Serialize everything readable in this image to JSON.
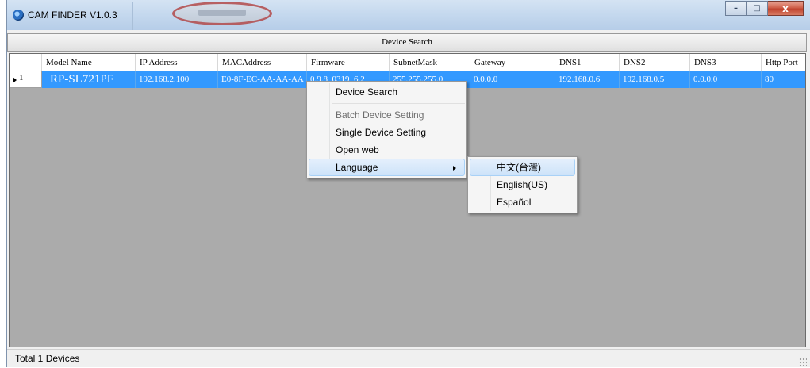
{
  "window": {
    "title": "CAM FINDER V1.0.3",
    "controls": {
      "minimize": "–",
      "maximize": "□",
      "close": "x"
    }
  },
  "toolbar": {
    "device_search_label": "Device Search"
  },
  "grid": {
    "columns": [
      "Model Name",
      "IP Address",
      "MACAddress",
      "Firmware",
      "SubnetMask",
      "Gateway",
      "DNS1",
      "DNS2",
      "DNS3",
      "Http Port"
    ],
    "rows": [
      {
        "row_number": "1",
        "model_name": "RP-SL721PF",
        "ip_address": "192.168.2.100",
        "mac_address": "E0-8F-EC-AA-AA-AA",
        "firmware": "0.9.8_0319_6.2",
        "subnet_mask": "255.255.255.0",
        "gateway": "0.0.0.0",
        "dns1": "192.168.0.6",
        "dns2": "192.168.0.5",
        "dns3": "0.0.0.0",
        "http_port": "80"
      }
    ]
  },
  "context_menu": {
    "device_search": "Device Search",
    "batch_device_setting": "Batch Device Setting",
    "single_device_setting": "Single Device Setting",
    "open_web": "Open web",
    "language": "Language"
  },
  "language_submenu": {
    "chinese": "中文(台灣)",
    "english": "English(US)",
    "spanish": "Español"
  },
  "status": {
    "total_devices": "Total 1 Devices"
  }
}
